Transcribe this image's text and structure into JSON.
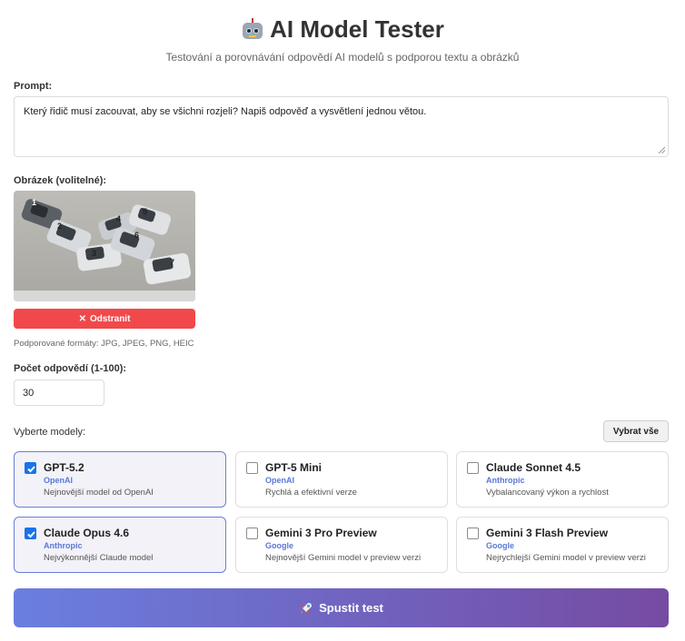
{
  "header": {
    "title": "AI Model Tester",
    "subtitle": "Testování a porovnávání odpovědí AI modelů s podporou textu a obrázků"
  },
  "prompt": {
    "label": "Prompt:",
    "value": "Který řidič musí zacouvat, aby se všichni rozjeli? Napiš odpověď a vysvětlení jednou větou."
  },
  "image": {
    "label": "Obrázek (volitelné):",
    "car_numbers": [
      "1",
      "2",
      "3",
      "4",
      "5",
      "6",
      "7"
    ],
    "remove_label": "Odstranit",
    "formats": "Podporované formáty: JPG, JPEG, PNG, HEIC"
  },
  "count": {
    "label": "Počet odpovědí (1-100):",
    "value": "30"
  },
  "models": {
    "label": "Vyberte modely:",
    "select_all": "Vybrat vše",
    "items": [
      {
        "name": "GPT-5.2",
        "vendor": "OpenAI",
        "desc": "Nejnovější model od OpenAI",
        "checked": true
      },
      {
        "name": "GPT-5 Mini",
        "vendor": "OpenAI",
        "desc": "Rychlá a efektivní verze",
        "checked": false
      },
      {
        "name": "Claude Sonnet 4.5",
        "vendor": "Anthropic",
        "desc": "Vybalancovaný výkon a rychlost",
        "checked": false
      },
      {
        "name": "Claude Opus 4.6",
        "vendor": "Anthropic",
        "desc": "Nejvýkonnější Claude model",
        "checked": true
      },
      {
        "name": "Gemini 3 Pro Preview",
        "vendor": "Google",
        "desc": "Nejnovější Gemini model v preview verzi",
        "checked": false
      },
      {
        "name": "Gemini 3 Flash Preview",
        "vendor": "Google",
        "desc": "Nejrychlejší Gemini model v preview verzi",
        "checked": false
      }
    ]
  },
  "run": {
    "label": "Spustit test"
  },
  "colors": {
    "accent": "#6a7fe0",
    "accent_end": "#764ba2",
    "danger": "#f1494b",
    "vendor": "#5a78d6",
    "checkbox": "#1a73e8"
  },
  "icons": {
    "title": "robot-icon",
    "remove": "close-icon",
    "run": "rocket-icon"
  }
}
